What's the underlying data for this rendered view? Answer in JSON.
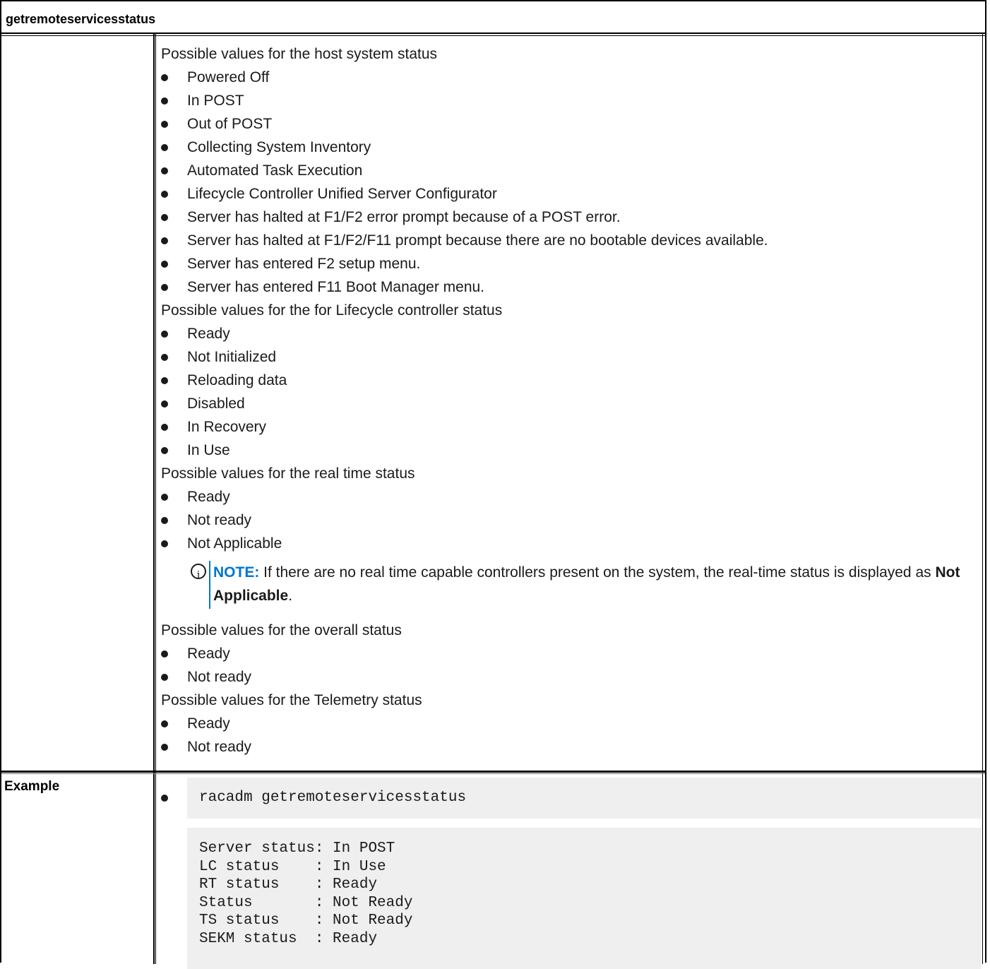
{
  "title": "getremoteservicesstatus",
  "sections": {
    "host": {
      "heading": "Possible values for the host system status",
      "items": [
        "Powered Off",
        "In POST",
        "Out of POST",
        "Collecting System Inventory",
        "Automated Task Execution",
        "Lifecycle Controller Unified Server Configurator",
        "Server has halted at F1/F2 error prompt because of a POST error.",
        "Server has halted at F1/F2/F11 prompt because there are no bootable devices available.",
        "Server has entered F2 setup menu.",
        "Server has entered F11 Boot Manager menu."
      ]
    },
    "lc": {
      "heading": "Possible values for the for Lifecycle controller status",
      "items": [
        "Ready",
        "Not Initialized",
        "Reloading data",
        "Disabled",
        "In Recovery",
        "In Use"
      ]
    },
    "rt": {
      "heading": "Possible values for the real time status",
      "items": [
        "Ready",
        "Not ready",
        "Not Applicable"
      ]
    },
    "overall": {
      "heading": "Possible values for the overall status",
      "items": [
        "Ready",
        "Not ready"
      ]
    },
    "telemetry": {
      "heading": "Possible values for the Telemetry status",
      "items": [
        "Ready",
        "Not ready"
      ]
    }
  },
  "note": {
    "label": "NOTE:",
    "text_before": " If there are no real time capable controllers present on the system, the real-time status is displayed as ",
    "bold": "Not Applicable",
    "text_after": ".",
    "accent_color": "#0076ce",
    "icon": "info-icon"
  },
  "example": {
    "label": "Example",
    "command": "racadm getremoteservicesstatus",
    "output": "Server status: In POST\nLC status    : In Use\nRT status    : Ready\nStatus       : Not Ready\nTS status    : Not Ready\nSEKM status  : Ready"
  }
}
